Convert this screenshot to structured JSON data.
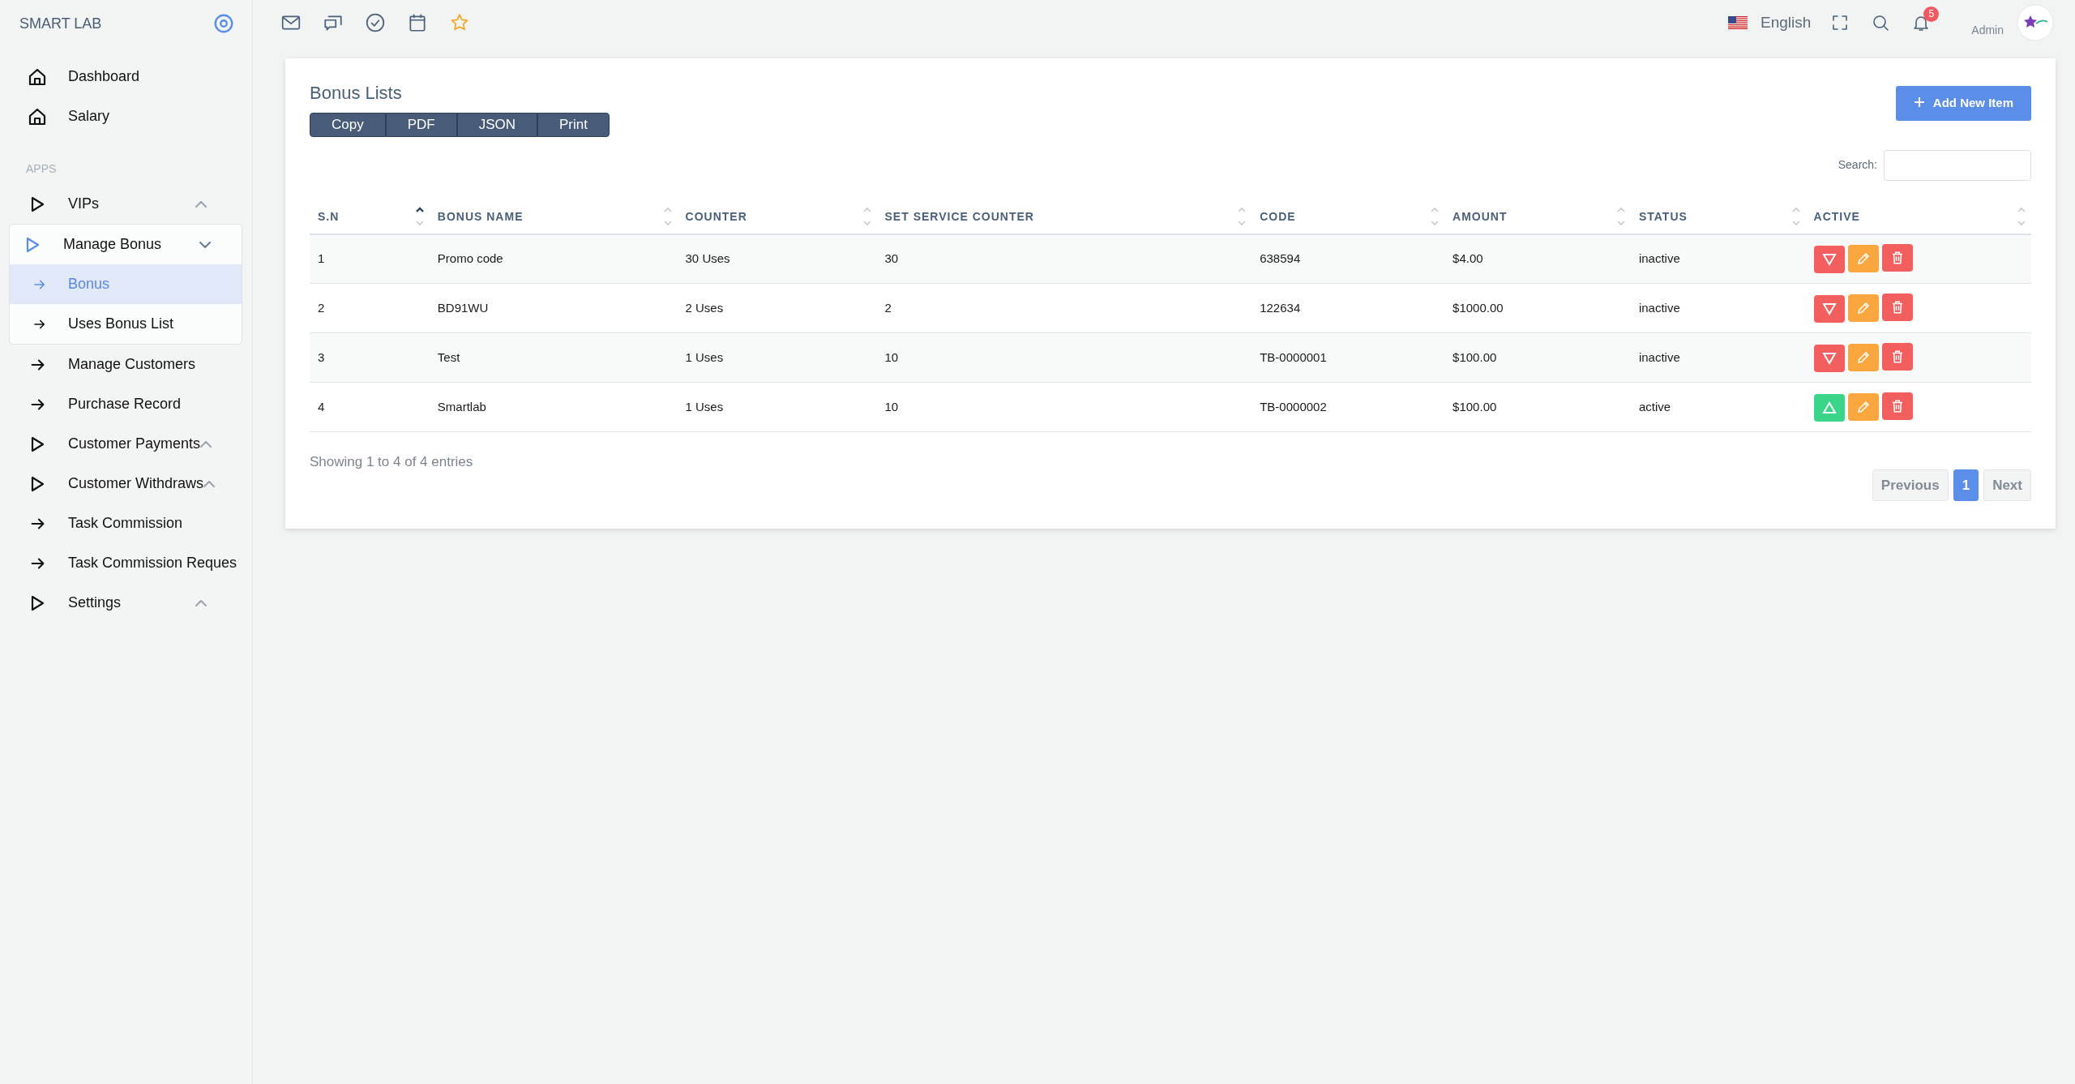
{
  "brand": "SMART LAB",
  "sidebar": {
    "items": [
      {
        "kind": "home",
        "label": "Dashboard"
      },
      {
        "kind": "home",
        "label": "Salary"
      },
      {
        "kind": "heading",
        "label": "APPS"
      },
      {
        "kind": "group",
        "label": "VIPs",
        "expanded": false
      },
      {
        "kind": "group",
        "label": "Manage Bonus",
        "expanded": true,
        "children": [
          {
            "label": "Bonus",
            "selected": true
          },
          {
            "label": "Uses Bonus List",
            "selected": false
          }
        ]
      },
      {
        "kind": "link",
        "label": "Manage Customers"
      },
      {
        "kind": "link",
        "label": "Purchase Record"
      },
      {
        "kind": "group",
        "label": "Customer Payments",
        "expanded": false
      },
      {
        "kind": "group",
        "label": "Customer Withdraws",
        "expanded": false
      },
      {
        "kind": "link",
        "label": "Task Commission"
      },
      {
        "kind": "link",
        "label": "Task Commission Reques"
      },
      {
        "kind": "group",
        "label": "Settings",
        "expanded": false
      }
    ]
  },
  "topbar": {
    "language": "English",
    "notifications": "5",
    "role": "Admin"
  },
  "card": {
    "title": "Bonus Lists",
    "export_buttons": [
      "Copy",
      "PDF",
      "JSON",
      "Print"
    ],
    "add_button": "Add New Item",
    "search_label": "Search:",
    "table": {
      "columns": [
        {
          "label": "S.N",
          "sorted": true
        },
        {
          "label": "BONUS NAME",
          "sorted": false
        },
        {
          "label": "COUNTER",
          "sorted": false
        },
        {
          "label": "SET SERVICE COUNTER",
          "sorted": false
        },
        {
          "label": "CODE",
          "sorted": false
        },
        {
          "label": "AMOUNT",
          "sorted": false
        },
        {
          "label": "STATUS",
          "sorted": false
        },
        {
          "label": "ACTIVE",
          "sorted": false
        }
      ],
      "rows": [
        {
          "cells": [
            "1",
            "Promo code",
            "30 Uses",
            "30",
            "638594",
            "$4.00",
            "inactive"
          ],
          "active": false
        },
        {
          "cells": [
            "2",
            "BD91WU",
            "2 Uses",
            "2",
            "122634",
            "$1000.00",
            "inactive"
          ],
          "active": false
        },
        {
          "cells": [
            "3",
            "Test",
            "1 Uses",
            "10",
            "TB-0000001",
            "$100.00",
            "inactive"
          ],
          "active": false
        },
        {
          "cells": [
            "4",
            "Smartlab",
            "1 Uses",
            "10",
            "TB-0000002",
            "$100.00",
            "active"
          ],
          "active": true
        }
      ]
    },
    "info": "Showing 1 to 4 of 4 entries",
    "pagination": [
      {
        "label": "Previous",
        "selected": false,
        "disabled": true
      },
      {
        "label": "1",
        "selected": true,
        "disabled": false
      },
      {
        "label": "Next",
        "selected": false,
        "disabled": true
      }
    ]
  }
}
